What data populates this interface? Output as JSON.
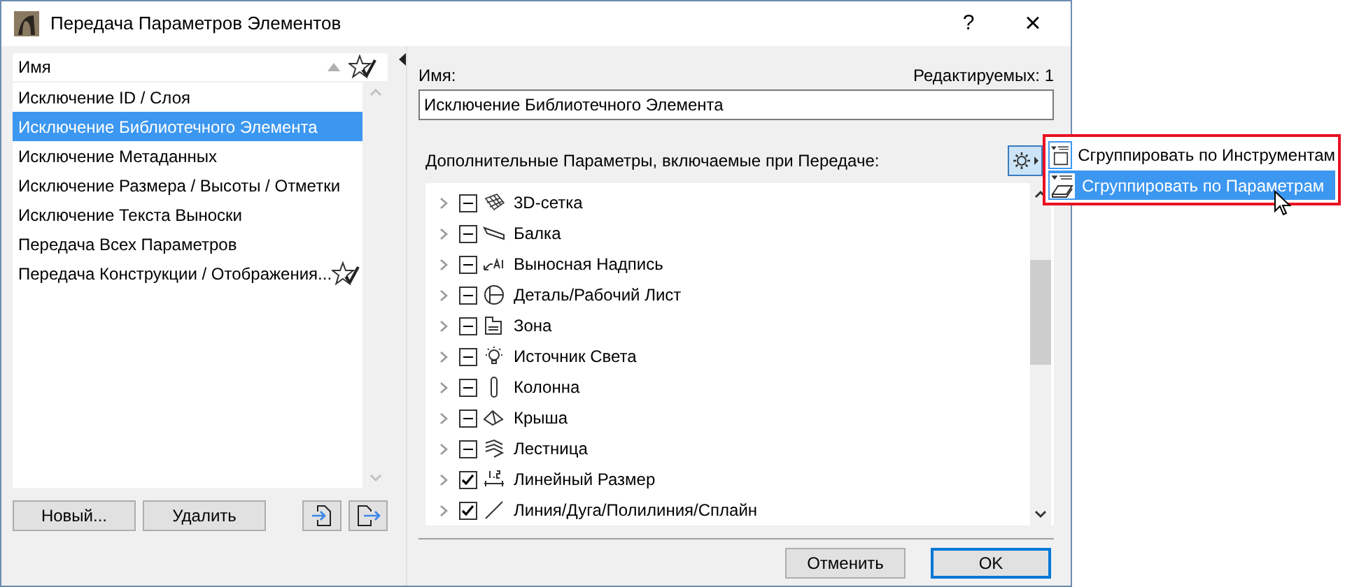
{
  "window": {
    "title": "Передача Параметров Элементов",
    "help": "?",
    "close": "×"
  },
  "sets": {
    "header": "Имя",
    "items": [
      {
        "label": "Исключение ID / Слоя",
        "selected": false,
        "favorite": false
      },
      {
        "label": "Исключение Библиотечного Элемента",
        "selected": true,
        "favorite": false
      },
      {
        "label": "Исключение Метаданных",
        "selected": false,
        "favorite": false
      },
      {
        "label": "Исключение Размера / Высоты / Отметки",
        "selected": false,
        "favorite": false
      },
      {
        "label": "Исключение Текста Выноски",
        "selected": false,
        "favorite": false
      },
      {
        "label": "Передача Всех Параметров",
        "selected": false,
        "favorite": false
      },
      {
        "label": "Передача Конструкции / Отображения...",
        "selected": false,
        "favorite": true
      }
    ],
    "buttons": [
      "Новый...",
      "Удалить"
    ]
  },
  "name_label": "Имя:",
  "editable": "Редактируемых: 1",
  "name_value": "Исключение Библиотечного Элемента",
  "params_label": "Дополнительные Параметры, включаемые при Передаче:",
  "params": [
    {
      "label": "3D-сетка",
      "checked": false,
      "mixed": true
    },
    {
      "label": "Балка",
      "checked": false,
      "mixed": true
    },
    {
      "label": "Выносная Надпись",
      "checked": false,
      "mixed": true
    },
    {
      "label": "Деталь/Рабочий Лист",
      "checked": false,
      "mixed": true
    },
    {
      "label": "Зона",
      "checked": false,
      "mixed": true
    },
    {
      "label": "Источник Света",
      "checked": false,
      "mixed": true
    },
    {
      "label": "Колонна",
      "checked": false,
      "mixed": true
    },
    {
      "label": "Крыша",
      "checked": false,
      "mixed": true
    },
    {
      "label": "Лестница",
      "checked": false,
      "mixed": true
    },
    {
      "label": "Линейный Размер",
      "checked": true,
      "mixed": false
    },
    {
      "label": "Линия/Дуга/Полилиния/Сплайн",
      "checked": true,
      "mixed": false
    }
  ],
  "group_menu": [
    {
      "label": "Сгруппировать по Инструментам",
      "selected": false
    },
    {
      "label": "Сгруппировать по Параметрам",
      "selected": true
    }
  ],
  "buttons": [
    "Отменить",
    "OK"
  ]
}
